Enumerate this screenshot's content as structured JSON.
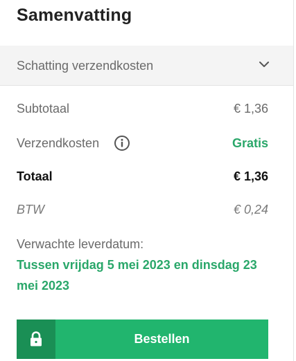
{
  "summary": {
    "title": "Samenvatting"
  },
  "shipping_estimate": {
    "label": "Schatting verzendkosten",
    "icon": "chevron-down-icon"
  },
  "lines": {
    "subtotal": {
      "label": "Subtotaal",
      "value": "€ 1,36"
    },
    "shipping": {
      "label": "Verzendkosten",
      "value": "Gratis",
      "icon": "info-icon"
    },
    "total": {
      "label": "Totaal",
      "value": "€ 1,36"
    },
    "vat": {
      "label": "BTW",
      "value": "€ 0,24"
    }
  },
  "delivery": {
    "label": "Verwachte leverdatum:",
    "value": "Tussen vrijdag 5 mei 2023 en dinsdag 23 mei 2023"
  },
  "order_button": {
    "label": "Bestellen",
    "icon": "lock-icon"
  },
  "colors": {
    "accent_green": "#21b56e",
    "accent_green_dark": "#1a8f55",
    "text_green": "#2aa76a"
  }
}
